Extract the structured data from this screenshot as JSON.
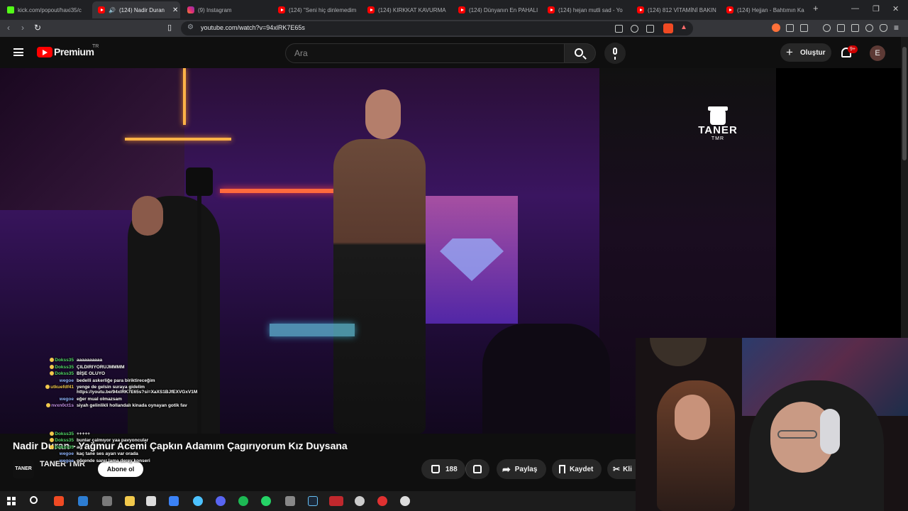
{
  "browser": {
    "tabs": [
      {
        "label": "kick.com/popout/haxi35/c",
        "favicon": "kick"
      },
      {
        "label": "(124) Nadir Duran",
        "favicon": "youtube",
        "active": true,
        "audio": true
      },
      {
        "label": "(9) Instagram",
        "favicon": "instagram"
      },
      {
        "label": "(124) \"Seni hiç dinlemedim",
        "favicon": "youtube"
      },
      {
        "label": "(124) KIRKKAT KAVURMA",
        "favicon": "youtube"
      },
      {
        "label": "(124) Dünyanın En PAHALI",
        "favicon": "youtube"
      },
      {
        "label": "(124) hejan mutli sad - Yo",
        "favicon": "youtube"
      },
      {
        "label": "(124) 812 VİTAMİNİ BAKIN",
        "favicon": "youtube"
      },
      {
        "label": "(124) Hejjan - Bahtımın Ka",
        "favicon": "youtube"
      }
    ],
    "new_tab_label": "+",
    "url": "youtube.com/watch?v=94xlRK7E65s"
  },
  "youtube": {
    "brand": "Premium",
    "region": "TR",
    "search_placeholder": "Ara",
    "create_label": "Oluştur",
    "notification_count": "9+",
    "avatar_letter": "E"
  },
  "video": {
    "title": "Nadir Duran - Yağmur Acemi Çapkın Adamım Çagırıyorum Kız Duysana",
    "channel_name": "TANER TMR",
    "channel_avatar_text": "TANER",
    "subscribe_label": "Abone ol",
    "like_count": "188",
    "share_label": "Paylaş",
    "save_label": "Kaydet",
    "clip_label": "Kli",
    "watermark_text": "TANER",
    "watermark_sub": "TMR"
  },
  "chat": [
    {
      "user": "Dokss35",
      "msg": "aaaaaaaaaa",
      "color": "#53d769",
      "badge": true
    },
    {
      "user": "Dokss35",
      "msg": "ÇILDIRIYORUJMMMM",
      "color": "#53d769",
      "badge": true
    },
    {
      "user": "Dokss35",
      "msg": "BİŞE OLUYO",
      "color": "#53d769",
      "badge": true
    },
    {
      "user": "wegoe",
      "msg": "bedelli askerliğe para biriktireceğim",
      "color": "#8fb4ff",
      "badge": false
    },
    {
      "user": "utkuefdf41",
      "msg": "yenge de gelsin suraya gidelim https://youtu.be/94xlRK7E65s?si=XaXS1BJfEXVGxV1M",
      "color": "#f2c94c",
      "badge": true
    },
    {
      "user": "wegoe",
      "msg": "eğer mual olmazsam",
      "color": "#8fb4ff",
      "badge": false
    },
    {
      "user": "nvxn0ct1s",
      "msg": "siyah gelinlikli hollandalı kinada oynayan gotik fav",
      "color": "#c792ea",
      "badge": true
    },
    {
      "user": "Dokss35",
      "msg": "+++++",
      "color": "#53d769",
      "badge": true
    },
    {
      "user": "Dokss35",
      "msg": "bunlar çalmıyor yaa pavyoncular",
      "color": "#53d769",
      "badge": true
    },
    {
      "user": "Dokss35",
      "msg": "aç",
      "color": "#53d769",
      "badge": true
    },
    {
      "user": "wegoe",
      "msg": "kaç tane ses ayarı var orada",
      "color": "#8fb4ff",
      "badge": false
    },
    {
      "user": "wegoe",
      "msg": "görende sanır lama derey konseri",
      "color": "#8fb4ff",
      "badge": false
    }
  ],
  "colors": {
    "youtube_red": "#ff0000",
    "background": "#0f0f0f",
    "pill": "#272727"
  }
}
